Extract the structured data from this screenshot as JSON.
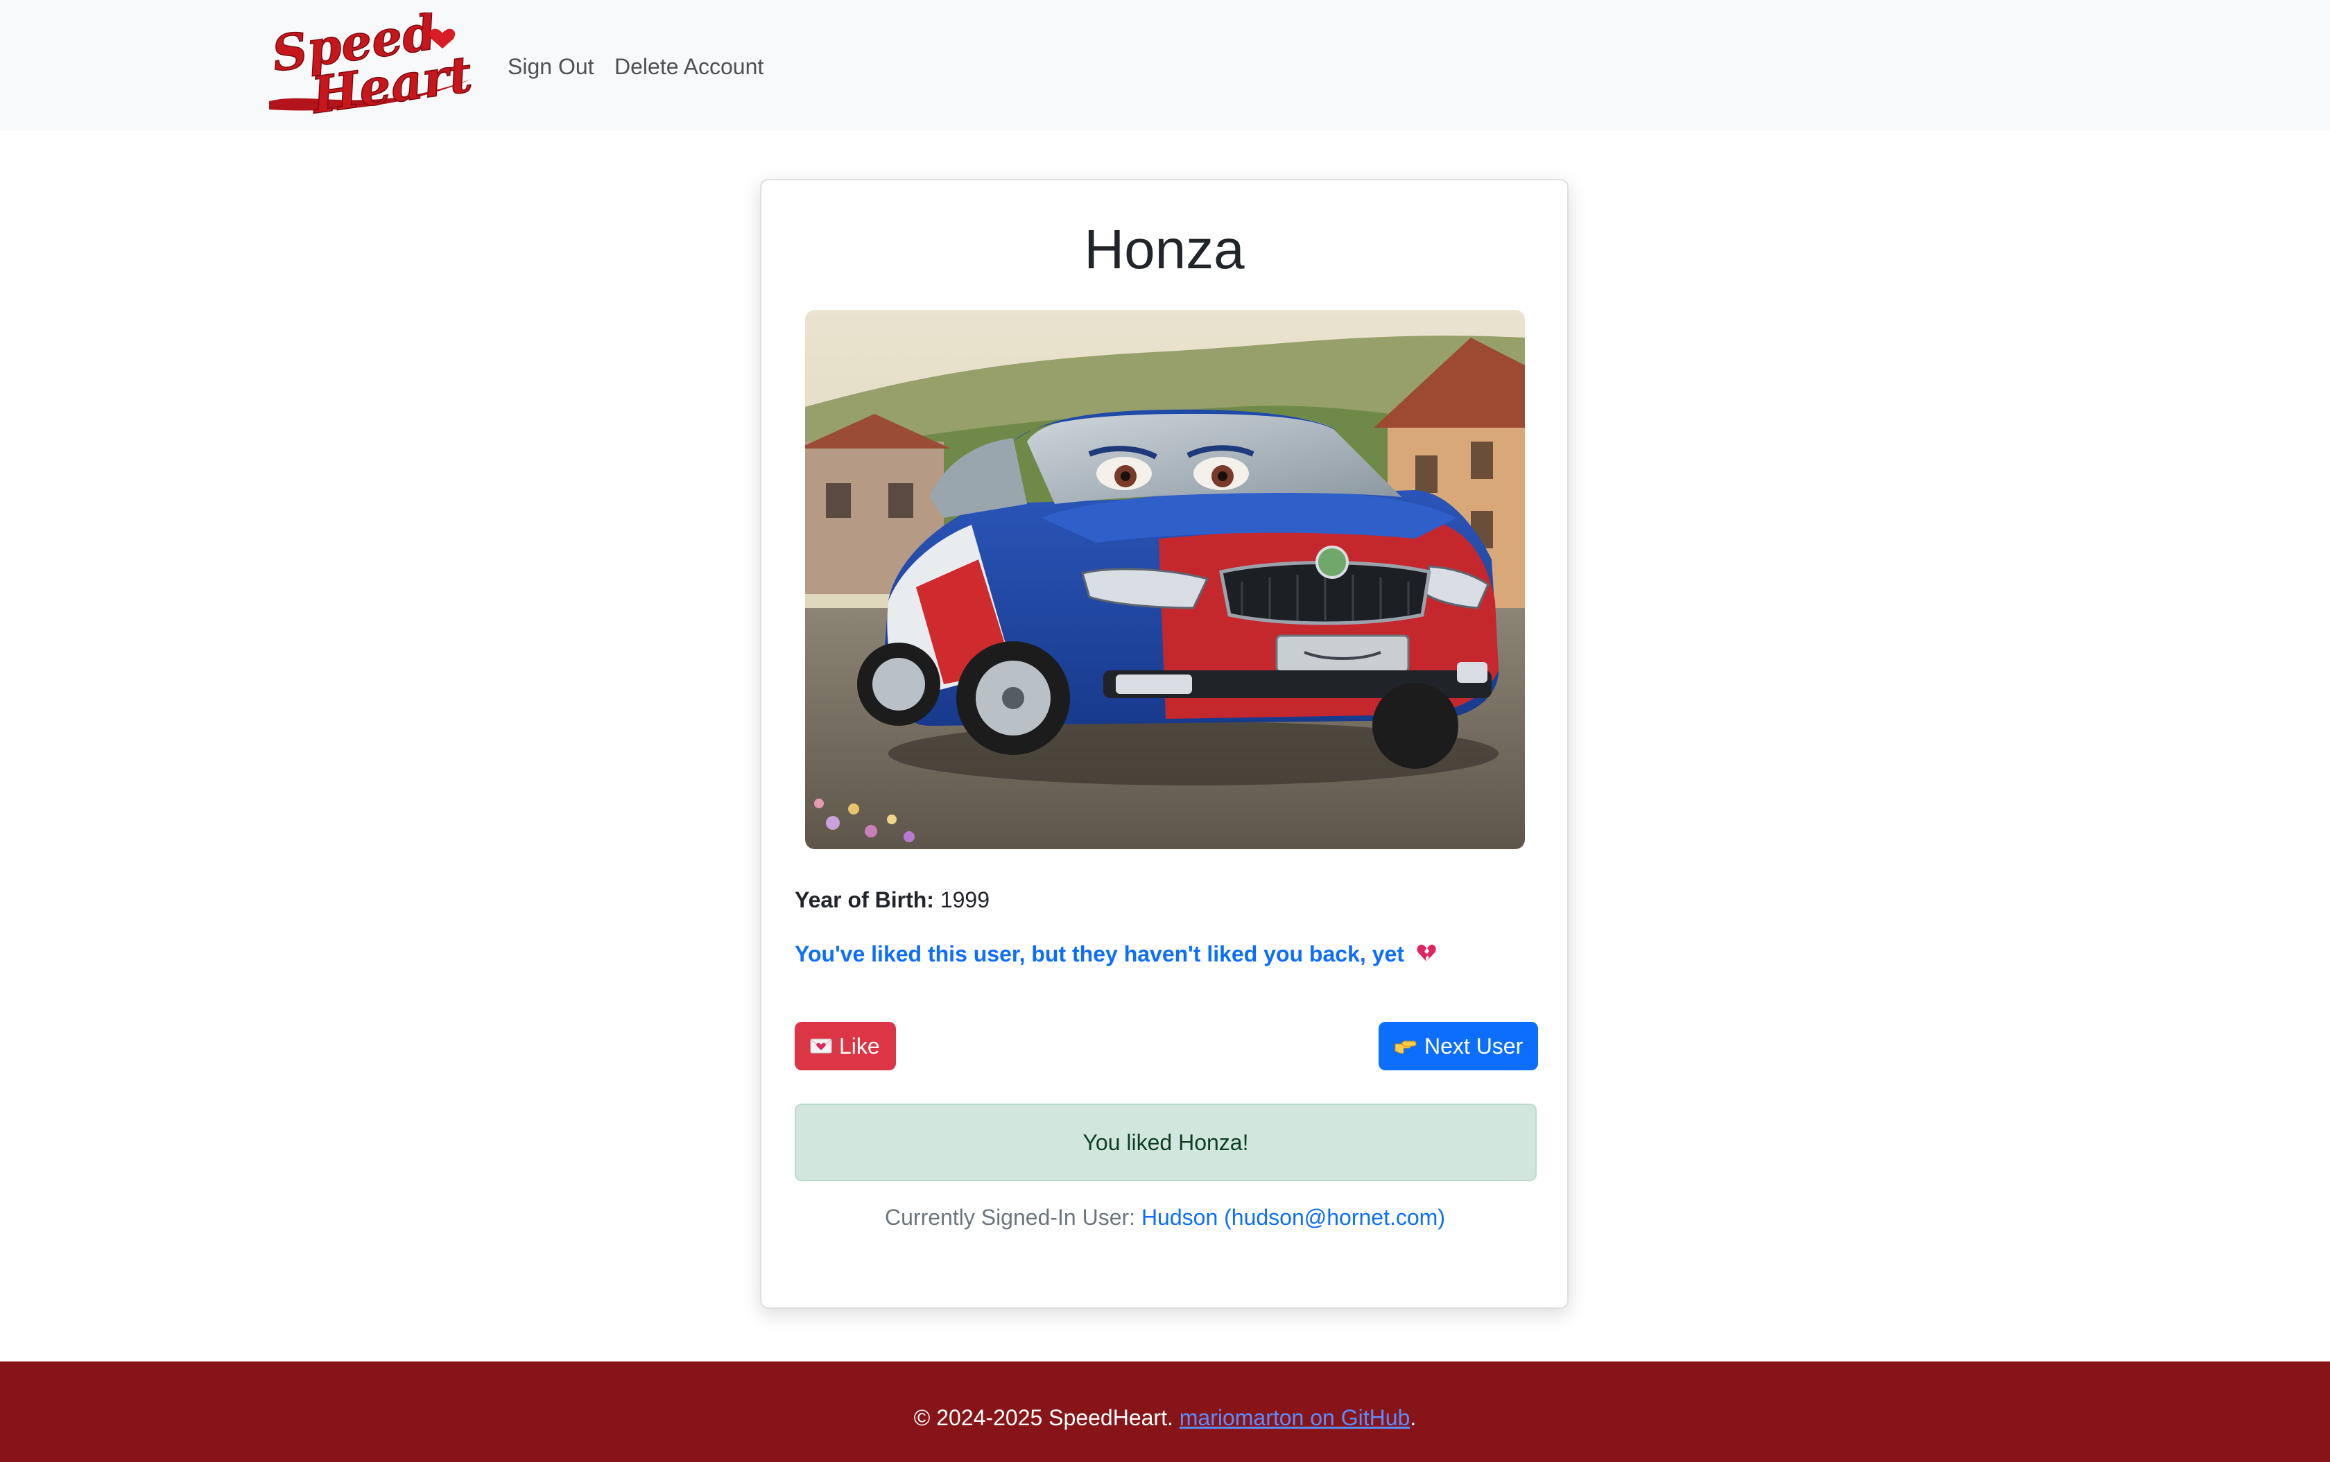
{
  "nav": {
    "brand": "SpeedHeart",
    "logo_line1": "Speed",
    "logo_line2": "Heart",
    "sign_out": "Sign Out",
    "delete_account": "Delete Account"
  },
  "profile": {
    "name": "Honza",
    "year_label": "Year of Birth:",
    "year_value": "1999",
    "like_status": "You've liked this user, but they haven't liked you back, yet"
  },
  "actions": {
    "like_label": "Like",
    "next_label": "Next User"
  },
  "alert": {
    "message": "You liked Honza!"
  },
  "session": {
    "label": "Currently Signed-In User:",
    "user": "Hudson (hudson@hornet.com)"
  },
  "footer": {
    "copyright": "© 2024-2025 SpeedHeart.",
    "link_text": "mariomarton on GitHub",
    "trailing": "."
  },
  "colors": {
    "navbar_bg": "#f8f9fa",
    "primary": "#0d6efd",
    "danger": "#dc3545",
    "success_bg": "#d1e7dd",
    "footer_bg": "#871518",
    "brand_red": "#c8161d"
  },
  "icons": {
    "like": "love-letter-icon",
    "next": "pointing-right-icon",
    "status": "broken-heart-icon"
  }
}
